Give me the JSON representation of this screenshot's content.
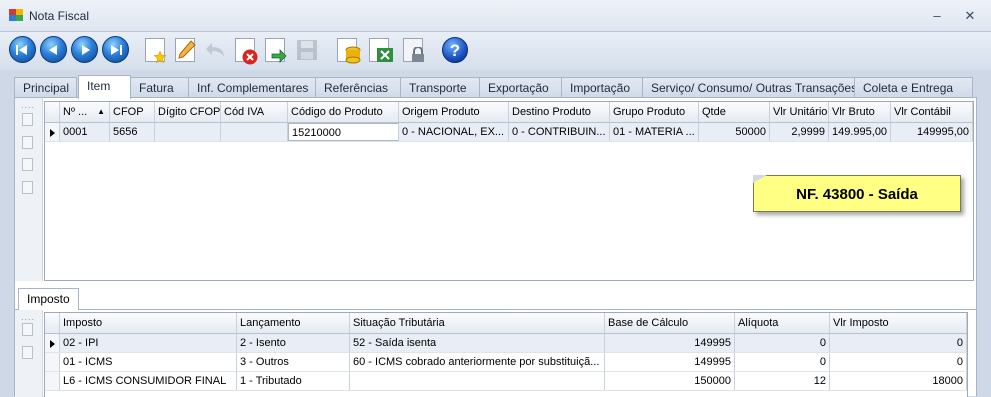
{
  "window": {
    "title": "Nota Fiscal",
    "minimize": "–",
    "close": "✕"
  },
  "colors": {
    "accent": "#2b7fd8",
    "note_bg": "#ffff84",
    "tab_border": "#a8b5c8"
  },
  "toolbar": {
    "buttons": [
      "first-record-icon",
      "previous-record-icon",
      "next-record-icon",
      "last-record-icon",
      "new-document-icon",
      "edit-icon",
      "undo-icon",
      "delete-icon",
      "refresh-icon",
      "save-icon",
      "coins-icon",
      "export-icon",
      "lock-icon",
      "help-icon"
    ],
    "help_glyph": "?"
  },
  "tabs": [
    "Principal",
    "Item",
    "Fatura",
    "Inf. Complementares",
    "Referências",
    "Transporte",
    "Exportação",
    "Importação",
    "Serviço/ Consumo/ Outras Transações",
    "Coleta e Entrega"
  ],
  "active_tab": "Item",
  "items_grid": {
    "columns": [
      "Nº ...",
      "CFOP",
      "Dígito CFOP",
      "Cód IVA",
      "Código do Produto",
      "Origem Produto",
      "Destino Produto",
      "Grupo Produto",
      "Qtde",
      "Vlr Unitário",
      "Vlr Bruto",
      "Vlr Contábil"
    ],
    "sort_indicator": "▲",
    "rows": [
      [
        "0001",
        "5656",
        "",
        "",
        "15210000",
        "0 - NACIONAL, EX...",
        "0 - CONTRIBUIN...",
        "01 - MATERIA ...",
        "50000",
        "2,9999",
        "149.995,00",
        "149995,00"
      ]
    ]
  },
  "note": {
    "text": "NF. 43800 - Saída"
  },
  "lower_tab": "Imposto",
  "tax_grid": {
    "columns": [
      "Imposto",
      "Lançamento",
      "Situação Tributária",
      "Base de Cálculo",
      "Alíquota",
      "Vlr Imposto"
    ],
    "rows": [
      [
        "02 - IPI",
        "2 - Isento",
        "52 - Saída isenta",
        "149995",
        "0",
        "0"
      ],
      [
        "01 - ICMS",
        "3 - Outros",
        "60 - ICMS cobrado anteriormente por substituiçã...",
        "149995",
        "0",
        "0"
      ],
      [
        "L6 - ICMS CONSUMIDOR FINAL",
        "1 - Tributado",
        "",
        "150000",
        "12",
        "18000"
      ]
    ]
  }
}
